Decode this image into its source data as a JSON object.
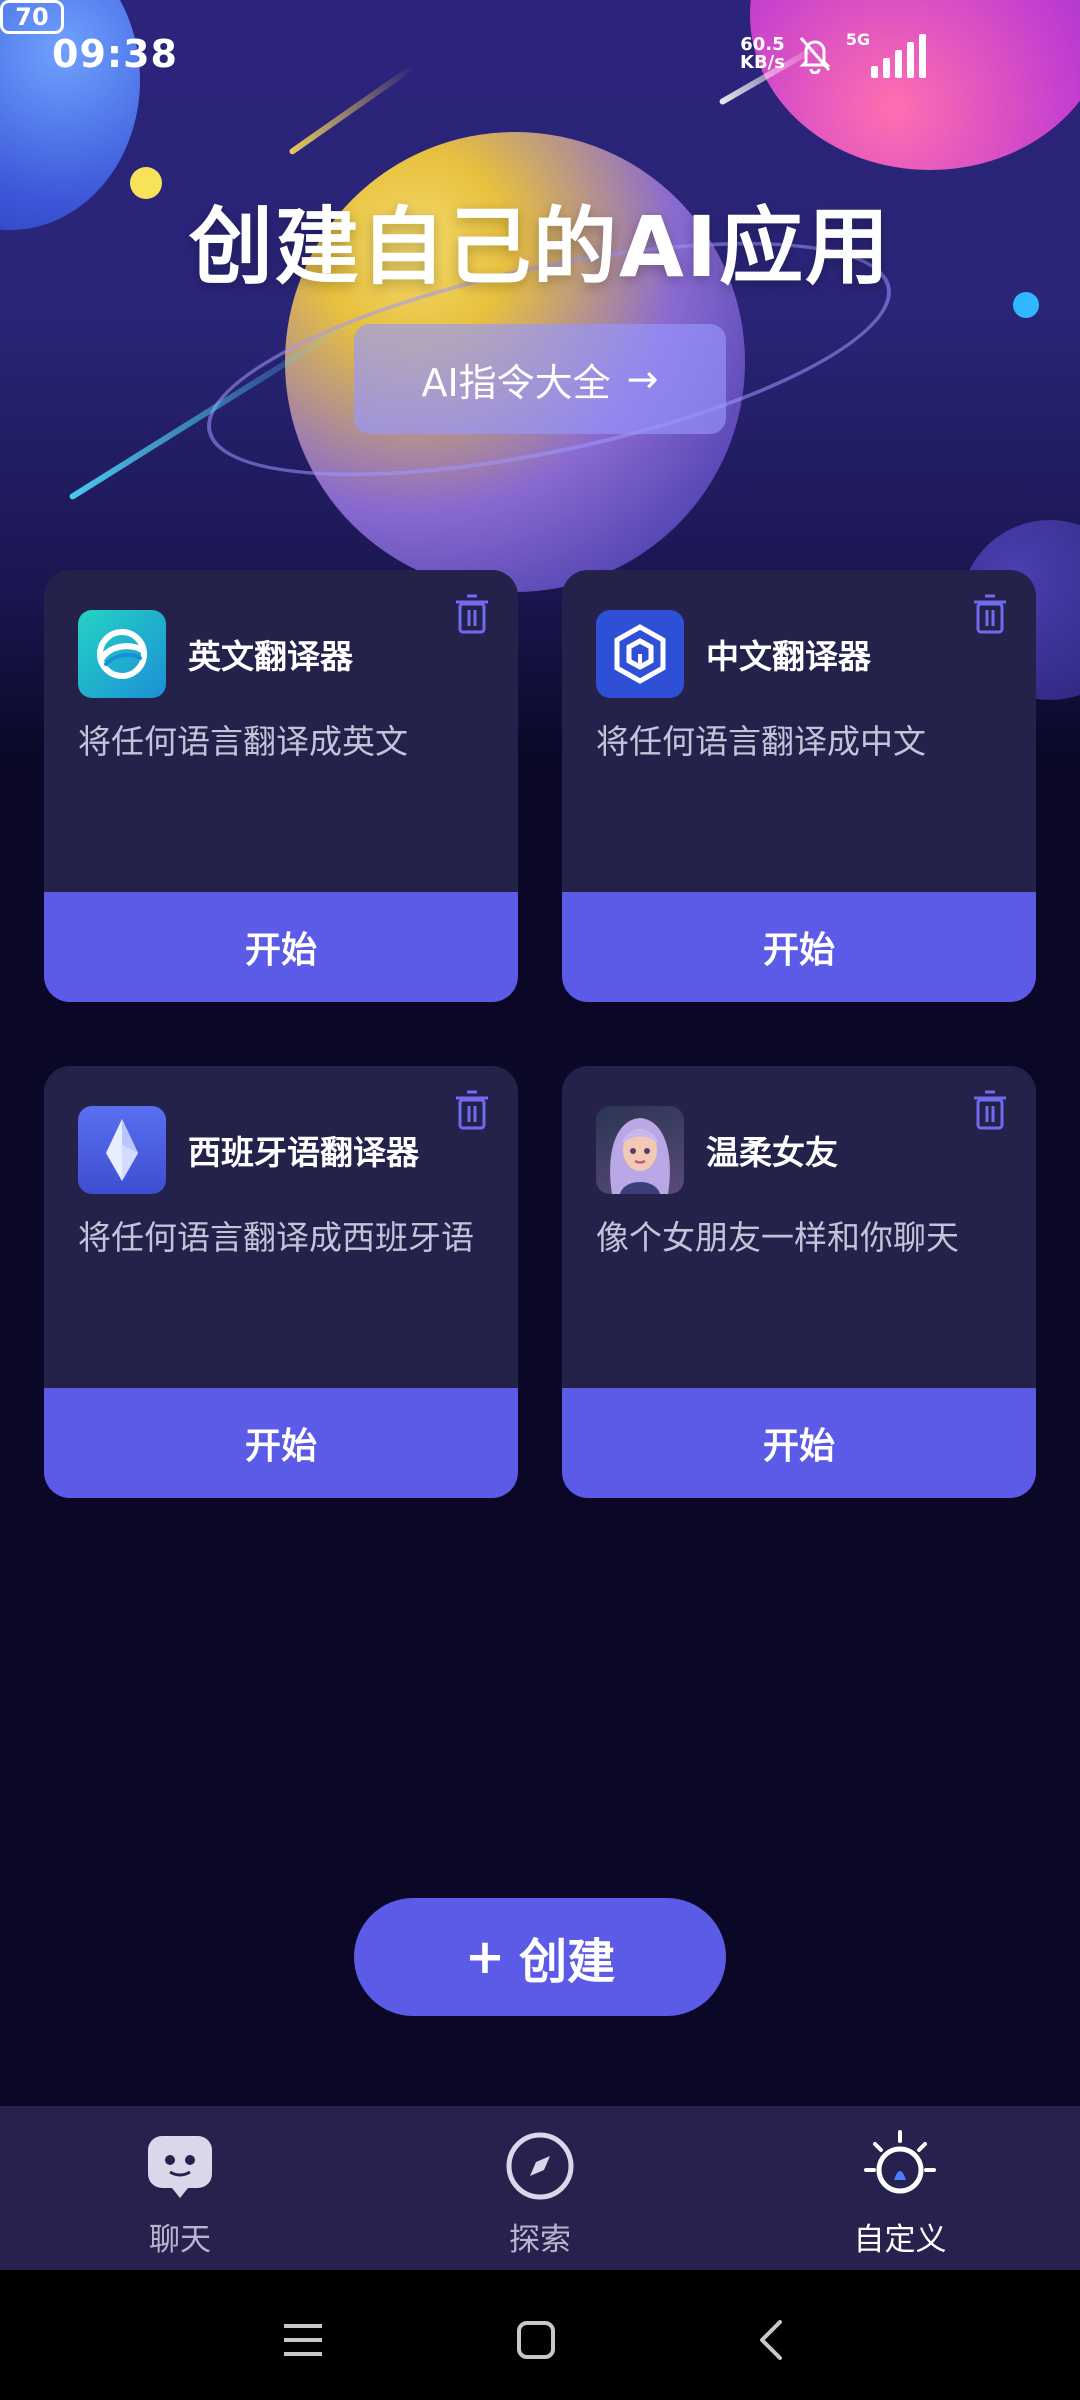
{
  "status_bar": {
    "time": "09:38",
    "net_speed_value": "60.5",
    "net_speed_unit": "KB/s",
    "network": "5G",
    "battery": "70"
  },
  "hero": {
    "title": "创建自己的AI应用",
    "guide_button": "AI指令大全",
    "guide_arrow": "→"
  },
  "cards": [
    {
      "title": "英文翻译器",
      "description": "将任何语言翻译成英文",
      "button": "开始",
      "icon": "globe-swirl-icon"
    },
    {
      "title": "中文翻译器",
      "description": "将任何语言翻译成中文",
      "button": "开始",
      "icon": "cube-icon"
    },
    {
      "title": "西班牙语翻译器",
      "description": "将任何语言翻译成西班牙语",
      "button": "开始",
      "icon": "crystal-icon"
    },
    {
      "title": "温柔女友",
      "description": "像个女朋友一样和你聊天",
      "button": "开始",
      "icon": "girl-avatar"
    }
  ],
  "create_button": {
    "plus": "+",
    "label": "创建"
  },
  "tabs": [
    {
      "label": "聊天",
      "icon": "robot-chat-icon"
    },
    {
      "label": "探索",
      "icon": "compass-icon"
    },
    {
      "label": "自定义",
      "icon": "bulb-icon",
      "active": true
    }
  ],
  "colors": {
    "accent": "#5c5be8",
    "card_bg": "#24214a",
    "page_bg": "#0a0826",
    "tabbar_bg": "#26224d"
  }
}
